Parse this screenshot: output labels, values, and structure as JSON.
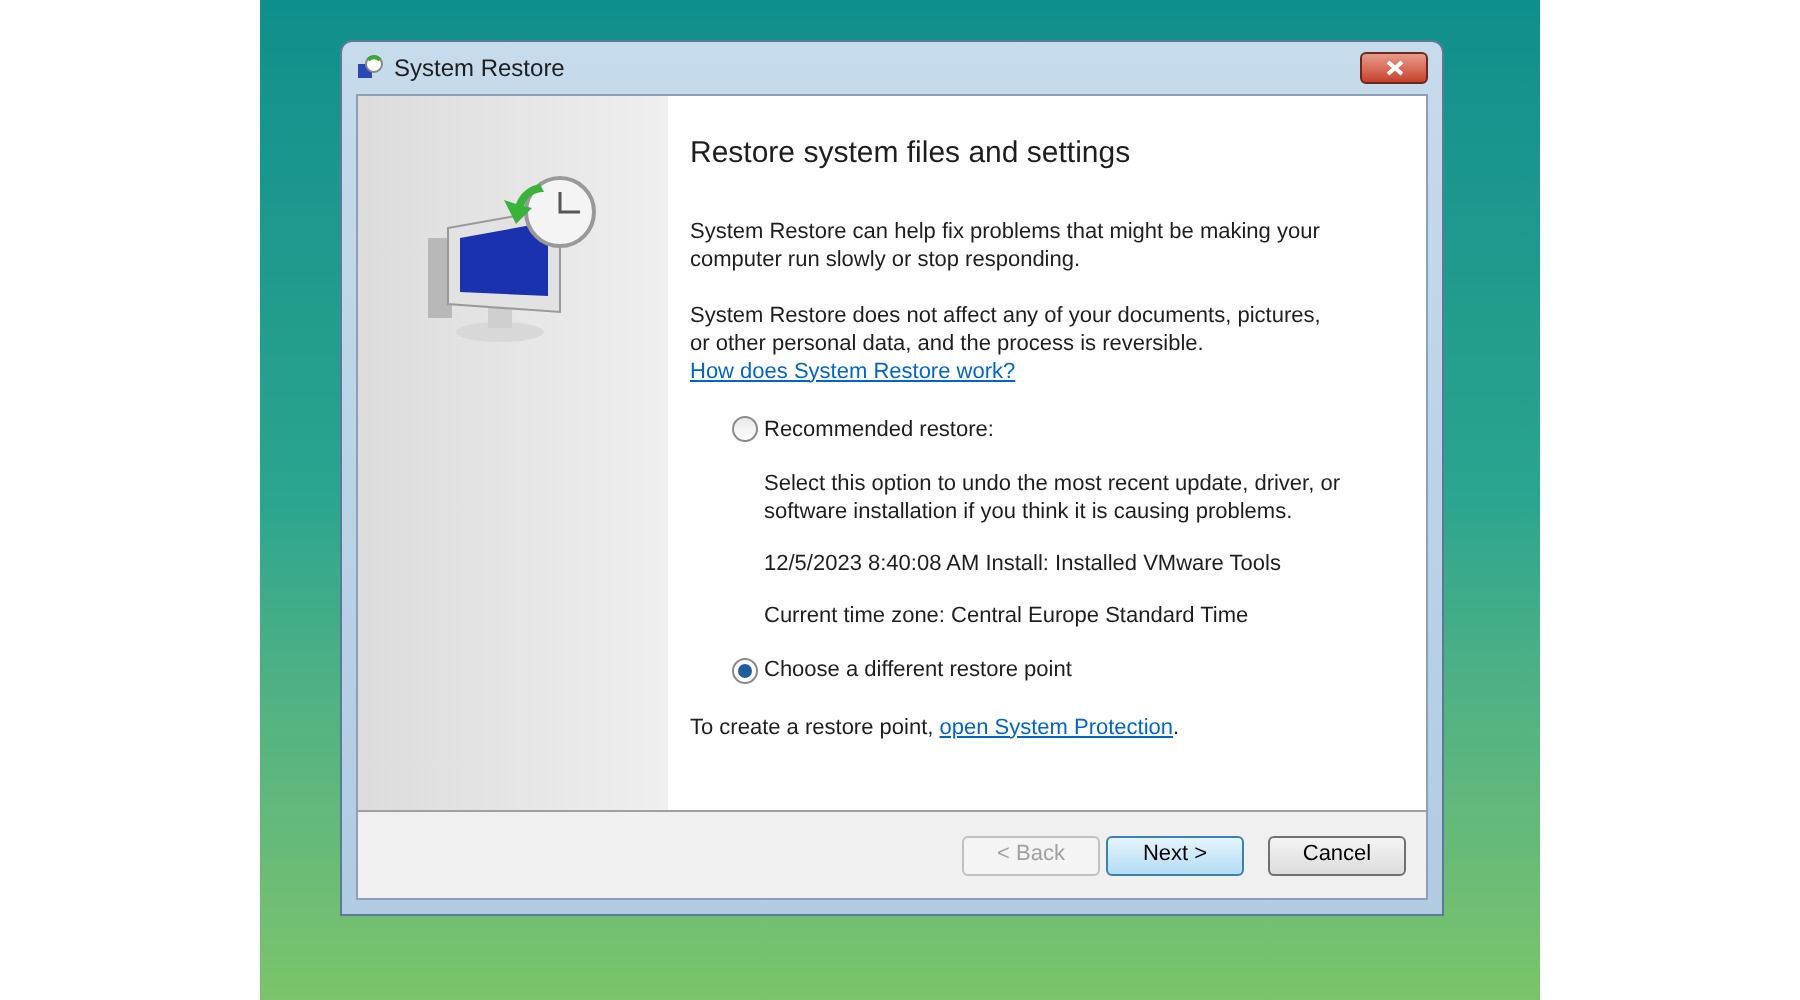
{
  "window": {
    "title": "System Restore"
  },
  "heading": "Restore system files and settings",
  "paragraphs": [
    {
      "text": "System Restore can help fix problems that might be making your computer run slowly or stop responding."
    },
    {
      "text": "System Restore does not affect any of your documents, pictures, or other personal data, and the process is reversible.",
      "link": "How does System Restore work?"
    }
  ],
  "options": [
    {
      "label": "Recommended restore:",
      "selected": false,
      "details": [
        "Select this option to undo the most recent update, driver, or software installation if you think it is causing problems.",
        "12/5/2023 8:40:08 AM Install: Installed VMware Tools",
        "Current time zone: Central Europe Standard Time"
      ]
    },
    {
      "label": "Choose a different restore point",
      "selected": true
    }
  ],
  "footer_note": {
    "text": "To create a restore point,",
    "link": "open System Protection",
    "after": "."
  },
  "buttons": [
    {
      "label": "< Back",
      "disabled": true,
      "default": false
    },
    {
      "label": "Next >",
      "disabled": false,
      "default": true
    },
    {
      "label": "Cancel",
      "disabled": false,
      "default": false
    }
  ]
}
